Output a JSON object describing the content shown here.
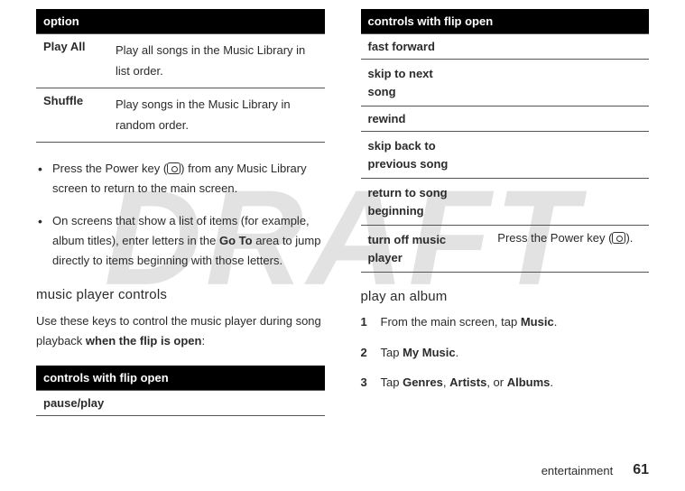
{
  "watermark": "DRAFT",
  "left": {
    "table_header": "option",
    "rows": [
      {
        "key": "Play All",
        "desc": "Play all songs in the Music Library in list order."
      },
      {
        "key": "Shuffle",
        "desc": "Play songs in the Music Library in random order."
      }
    ],
    "bullets": [
      {
        "pre": "Press the Power key (",
        "post": ") from any Music Library screen to return to the main screen."
      },
      {
        "pre": "On screens that show a list of items (for example, album titles), enter letters in the ",
        "goto": "Go To",
        "post2": " area to jump directly to items beginning with those letters."
      }
    ],
    "heading": "music player controls",
    "intro_pre": "Use these keys to control the music player during song playback ",
    "intro_bold": "when the flip is open",
    "intro_post": ":",
    "left_ctrl_header": "controls with flip open",
    "left_ctrl_rows": [
      {
        "key": "pause/play",
        "desc": ""
      }
    ]
  },
  "right": {
    "ctrl_header": "controls with flip open",
    "ctrl_rows": [
      {
        "key": "fast forward",
        "key2": "",
        "desc": ""
      },
      {
        "key": "skip to next",
        "key2": "song",
        "desc": ""
      },
      {
        "key": "rewind",
        "key2": "",
        "desc": ""
      },
      {
        "key": "skip back to",
        "key2": "previous song",
        "desc": ""
      },
      {
        "key": "return to song",
        "key2": "beginning",
        "desc": ""
      },
      {
        "key": "turn off music",
        "key2": "player",
        "desc_pre": "Press the Power key (",
        "desc_post": ")."
      }
    ],
    "play_heading": "play an album",
    "steps": [
      {
        "num": "1",
        "pre": "From the main screen, tap ",
        "bold": "Music",
        "post": "."
      },
      {
        "num": "2",
        "pre": "Tap ",
        "bold": "My Music",
        "post": "."
      },
      {
        "num": "3",
        "pre": "Tap ",
        "b1": "Genres",
        "sep1": ", ",
        "b2": "Artists",
        "sep2": ", or ",
        "b3": "Albums",
        "post": "."
      }
    ]
  },
  "footer": {
    "section": "entertainment",
    "page": "61"
  }
}
